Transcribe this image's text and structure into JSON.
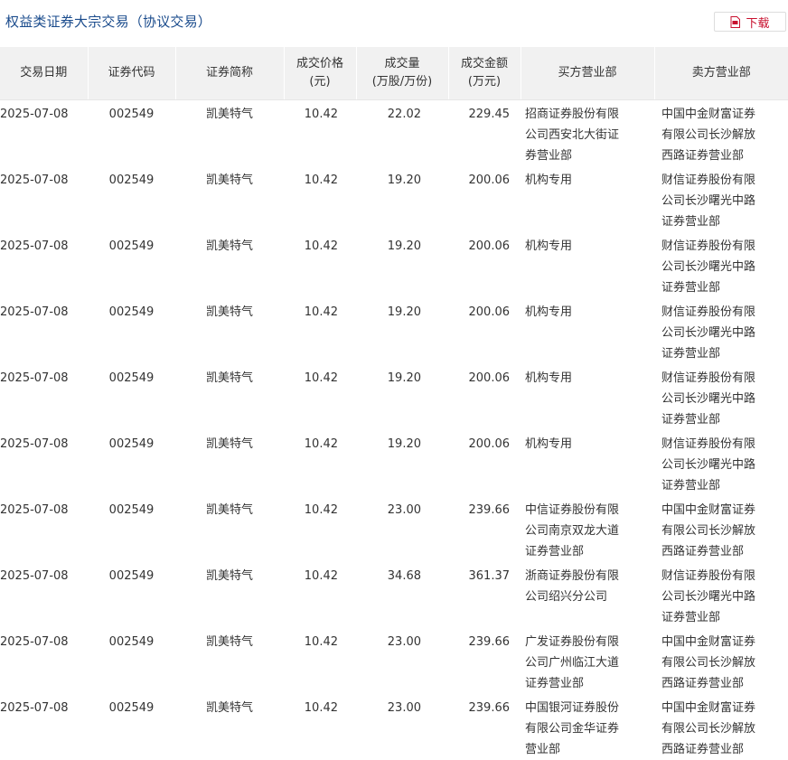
{
  "page": {
    "title": "权益类证券大宗交易（协议交易）",
    "download_label": "下载",
    "accent_color": "#1a4b8c",
    "download_color": "#c8102e",
    "download_icon": "pdf-icon"
  },
  "table": {
    "headers": [
      [
        "交易日期"
      ],
      [
        "证券代码"
      ],
      [
        "证券简称"
      ],
      [
        "成交价格",
        "(元)"
      ],
      [
        "成交量",
        "(万股/万份)"
      ],
      [
        "成交金额",
        "(万元)"
      ],
      [
        "买方营业部"
      ],
      [
        "卖方营业部"
      ]
    ],
    "rows": [
      [
        "2025-07-08",
        "002549",
        "凯美特气",
        "10.42",
        "22.02",
        "229.45",
        "招商证券股份有限公司西安北大街证券营业部",
        "中国中金财富证券有限公司长沙解放西路证券营业部"
      ],
      [
        "2025-07-08",
        "002549",
        "凯美特气",
        "10.42",
        "19.20",
        "200.06",
        "机构专用",
        "财信证券股份有限公司长沙曙光中路证券营业部"
      ],
      [
        "2025-07-08",
        "002549",
        "凯美特气",
        "10.42",
        "19.20",
        "200.06",
        "机构专用",
        "财信证券股份有限公司长沙曙光中路证券营业部"
      ],
      [
        "2025-07-08",
        "002549",
        "凯美特气",
        "10.42",
        "19.20",
        "200.06",
        "机构专用",
        "财信证券股份有限公司长沙曙光中路证券营业部"
      ],
      [
        "2025-07-08",
        "002549",
        "凯美特气",
        "10.42",
        "19.20",
        "200.06",
        "机构专用",
        "财信证券股份有限公司长沙曙光中路证券营业部"
      ],
      [
        "2025-07-08",
        "002549",
        "凯美特气",
        "10.42",
        "19.20",
        "200.06",
        "机构专用",
        "财信证券股份有限公司长沙曙光中路证券营业部"
      ],
      [
        "2025-07-08",
        "002549",
        "凯美特气",
        "10.42",
        "23.00",
        "239.66",
        "中信证券股份有限公司南京双龙大道证券营业部",
        "中国中金财富证券有限公司长沙解放西路证券营业部"
      ],
      [
        "2025-07-08",
        "002549",
        "凯美特气",
        "10.42",
        "34.68",
        "361.37",
        "浙商证券股份有限公司绍兴分公司",
        "财信证券股份有限公司长沙曙光中路证券营业部"
      ],
      [
        "2025-07-08",
        "002549",
        "凯美特气",
        "10.42",
        "23.00",
        "239.66",
        "广发证券股份有限公司广州临江大道证券营业部",
        "中国中金财富证券有限公司长沙解放西路证券营业部"
      ],
      [
        "2025-07-08",
        "002549",
        "凯美特气",
        "10.42",
        "23.00",
        "239.66",
        "中国银河证券股份有限公司金华证券营业部",
        "中国中金财富证券有限公司长沙解放西路证券营业部"
      ]
    ]
  }
}
